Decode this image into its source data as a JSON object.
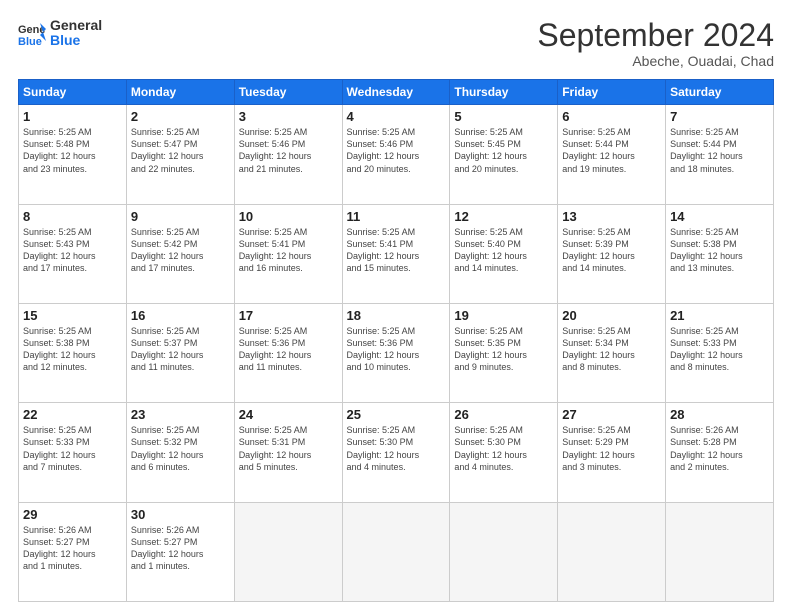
{
  "header": {
    "logo_line1": "General",
    "logo_line2": "Blue",
    "title": "September 2024",
    "subtitle": "Abeche, Ouadai, Chad"
  },
  "weekdays": [
    "Sunday",
    "Monday",
    "Tuesday",
    "Wednesday",
    "Thursday",
    "Friday",
    "Saturday"
  ],
  "weeks": [
    [
      {
        "num": "1",
        "rise": "5:25 AM",
        "set": "5:48 PM",
        "hours": "12",
        "mins": "23"
      },
      {
        "num": "2",
        "rise": "5:25 AM",
        "set": "5:47 PM",
        "hours": "12",
        "mins": "22"
      },
      {
        "num": "3",
        "rise": "5:25 AM",
        "set": "5:46 PM",
        "hours": "12",
        "mins": "21"
      },
      {
        "num": "4",
        "rise": "5:25 AM",
        "set": "5:46 PM",
        "hours": "12",
        "mins": "20"
      },
      {
        "num": "5",
        "rise": "5:25 AM",
        "set": "5:45 PM",
        "hours": "12",
        "mins": "20"
      },
      {
        "num": "6",
        "rise": "5:25 AM",
        "set": "5:44 PM",
        "hours": "12",
        "mins": "19"
      },
      {
        "num": "7",
        "rise": "5:25 AM",
        "set": "5:44 PM",
        "hours": "12",
        "mins": "18"
      }
    ],
    [
      {
        "num": "8",
        "rise": "5:25 AM",
        "set": "5:43 PM",
        "hours": "12",
        "mins": "17"
      },
      {
        "num": "9",
        "rise": "5:25 AM",
        "set": "5:42 PM",
        "hours": "12",
        "mins": "17"
      },
      {
        "num": "10",
        "rise": "5:25 AM",
        "set": "5:41 PM",
        "hours": "12",
        "mins": "16"
      },
      {
        "num": "11",
        "rise": "5:25 AM",
        "set": "5:41 PM",
        "hours": "12",
        "mins": "15"
      },
      {
        "num": "12",
        "rise": "5:25 AM",
        "set": "5:40 PM",
        "hours": "12",
        "mins": "14"
      },
      {
        "num": "13",
        "rise": "5:25 AM",
        "set": "5:39 PM",
        "hours": "12",
        "mins": "14"
      },
      {
        "num": "14",
        "rise": "5:25 AM",
        "set": "5:38 PM",
        "hours": "12",
        "mins": "13"
      }
    ],
    [
      {
        "num": "15",
        "rise": "5:25 AM",
        "set": "5:38 PM",
        "hours": "12",
        "mins": "12"
      },
      {
        "num": "16",
        "rise": "5:25 AM",
        "set": "5:37 PM",
        "hours": "12",
        "mins": "11"
      },
      {
        "num": "17",
        "rise": "5:25 AM",
        "set": "5:36 PM",
        "hours": "12",
        "mins": "11"
      },
      {
        "num": "18",
        "rise": "5:25 AM",
        "set": "5:36 PM",
        "hours": "12",
        "mins": "10"
      },
      {
        "num": "19",
        "rise": "5:25 AM",
        "set": "5:35 PM",
        "hours": "12",
        "mins": "9"
      },
      {
        "num": "20",
        "rise": "5:25 AM",
        "set": "5:34 PM",
        "hours": "12",
        "mins": "8"
      },
      {
        "num": "21",
        "rise": "5:25 AM",
        "set": "5:33 PM",
        "hours": "12",
        "mins": "8"
      }
    ],
    [
      {
        "num": "22",
        "rise": "5:25 AM",
        "set": "5:33 PM",
        "hours": "12",
        "mins": "7"
      },
      {
        "num": "23",
        "rise": "5:25 AM",
        "set": "5:32 PM",
        "hours": "12",
        "mins": "6"
      },
      {
        "num": "24",
        "rise": "5:25 AM",
        "set": "5:31 PM",
        "hours": "12",
        "mins": "5"
      },
      {
        "num": "25",
        "rise": "5:25 AM",
        "set": "5:30 PM",
        "hours": "12",
        "mins": "4"
      },
      {
        "num": "26",
        "rise": "5:25 AM",
        "set": "5:30 PM",
        "hours": "12",
        "mins": "4"
      },
      {
        "num": "27",
        "rise": "5:25 AM",
        "set": "5:29 PM",
        "hours": "12",
        "mins": "3"
      },
      {
        "num": "28",
        "rise": "5:26 AM",
        "set": "5:28 PM",
        "hours": "12",
        "mins": "2"
      }
    ],
    [
      {
        "num": "29",
        "rise": "5:26 AM",
        "set": "5:27 PM",
        "hours": "12",
        "mins": "1"
      },
      {
        "num": "30",
        "rise": "5:26 AM",
        "set": "5:27 PM",
        "hours": "12",
        "mins": "1"
      },
      null,
      null,
      null,
      null,
      null
    ]
  ]
}
